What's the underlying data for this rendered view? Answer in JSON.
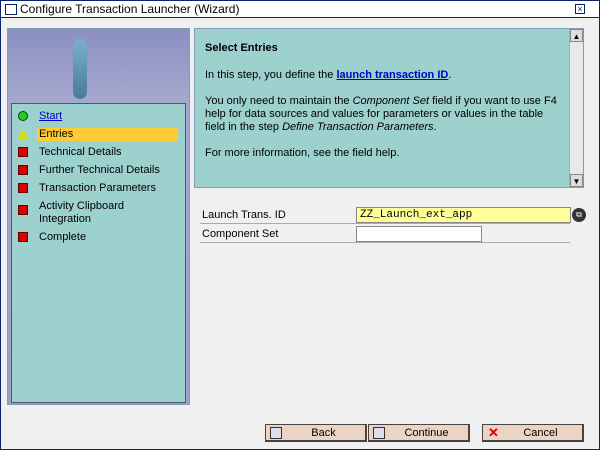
{
  "window": {
    "title": "Configure Transaction Launcher (Wizard)"
  },
  "steps": [
    {
      "label": "Start",
      "status": "done",
      "link": true
    },
    {
      "label": "Entries",
      "status": "current"
    },
    {
      "label": "Technical Details",
      "status": "open"
    },
    {
      "label": "Further Technical Details",
      "status": "open"
    },
    {
      "label": "Transaction Parameters",
      "status": "open"
    },
    {
      "label": "Activity Clipboard Integration",
      "status": "open"
    },
    {
      "label": "Complete",
      "status": "open"
    }
  ],
  "info": {
    "heading": "Select Entries",
    "p1_pre": "In this step, you define the ",
    "p1_link": "launch transaction ID",
    "p1_post": ".",
    "p2_a": "You only need to maintain the ",
    "p2_em1": "Component Set",
    "p2_b": " field if you want to use F4 help for data sources and values for parameters or values in the table field in the step ",
    "p2_em2": "Define Transaction Parameters",
    "p2_c": ".",
    "p3": "For more information, see the field help."
  },
  "form": {
    "launch_label": "Launch Trans. ID",
    "launch_value": "ZZ_Launch_ext_app",
    "component_label": "Component Set",
    "component_value": ""
  },
  "buttons": {
    "back": "Back",
    "continue": "Continue",
    "cancel": "Cancel"
  }
}
